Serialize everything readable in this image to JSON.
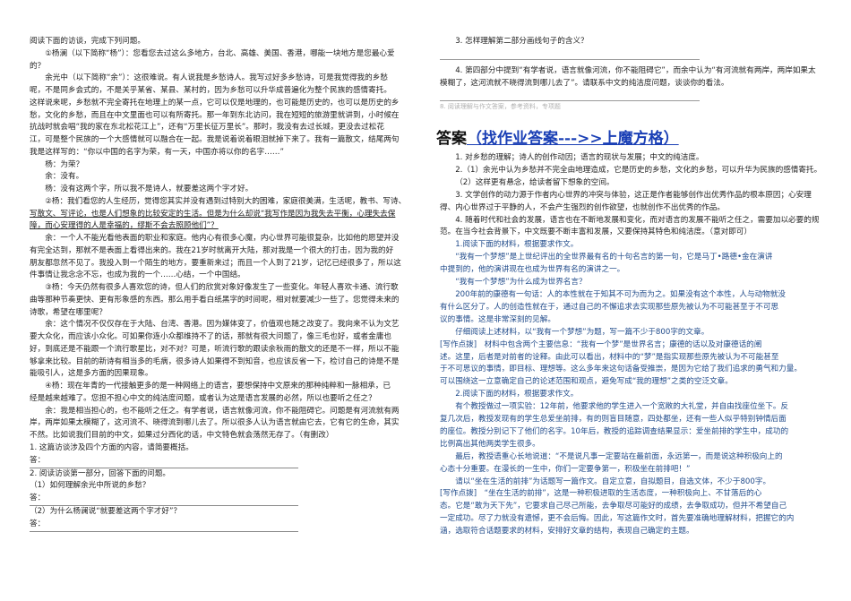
{
  "left": {
    "intro": "阅读下面的访谈，完成下列问题。",
    "paras": [
      "①杨澜（以下简称“杨”）：您看您去过这么多地方，台北、高雄、美国、香港，哪能一块地方是您最心爱",
      "的？",
      "余光中（以下简称“余”）：这很难说。有人说我是乡愁诗人。我写过好多乡愁诗，可是我觉得我的乡愁",
      "呢，不是同乡会式的，不是关乎某省、某县、某村的，因为乡愁可以升华成普遍化为整个民族的感情寄托。",
      "这样说来呢，乡愁就不完全寄托在地理上的某一点，它可以仅是地理的，也可能是历史的，也可以是历史的乡",
      "愁，文化的乡愁，而且在中文里面也可以有所寄托。那一年到东北访问，我在短短的旅游里就讲到，小时候在",
      "抗战时就会唱“我的家在东北松花江上”，还有“万里长征万里长”。那时，我没有去过长城，更没去过松花",
      "江，可是整个民族的一个大感情就可以融合在一起。我是说着说着眼泪就掉下来了。我有一篇散文，结尾两句",
      "我是这样写的：“你以中国的名字为荣，有一天，中国亦将以你的名字……”",
      "杨：为荣？",
      "余：没有。",
      "杨：没有这两个字，所以我不是诗人，就要差这两个字才好。",
      "②杨：我们看您的人生经历，觉得您其实并没有遇到过特别大的困难，家庭很美满，生活呢，教书、写诗、",
      "写散文、写评论，也是人们想象的比较安定的生活。但是为什么却说“我写作是因为我失去平衡，心理失去保",
      "障，而心安理得的人是幸福的，缪斯不会去照顾他们”？",
      "余：一个人不能光看他表面的职业和家庭。他内心有很多心魔，内心世界可能很复杂，比如他的愿望并没",
      "有完全达到，那就不是表面上看得出来的。我在21岁时就离开大陆，那对我是一个很大的打击，因为我的好",
      "朋友都忽然不见了。我投入到一个陌生的地方，要重新来过；而且一个人到了21岁，记忆已经很多了，所以这",
      "件事情让我念念不忘，也成为我的一个……心结，一个中国结。",
      "③杨：今天仍然有很多人喜欢您的诗，但人们的欣赏对象好像发生了一些变化。年轻人喜欢卡通、流行歌",
      "曲等那种节奏更快、更有形象感的东西。那么用手看白纸黑字的时间呢，相对就要减少一些了。您觉得未来的",
      "诗歌，希望在哪里呢？",
      "余：这个情况不仅仅存在于大陆、台湾、香港。因为媒体变了，价值观也随之改变了。我向来不认为文艺",
      "要大众化，而应该小众化。可如果你连小众都维持不了的话，那就有很大问题了，像三毛也好，或者金庸也",
      "好，到底还是不能跟一个流行歌星比，对不对？可是，听流行歌的跟读余秋雨的散文的还是不一样，所以不能",
      "够拿来比较。目前的新诗有相当多的毛病，很多诗人如果得不到知音，也应该反省一下，检讨自己的诗是不是",
      "能吸引人，这是多方面的因果现象。",
      "④杨：现在年青的一代接触更多的是一种网络上的语言，要想保持中文原来的那种纯粹和一脉相承，已",
      "经是越来越难了。您担不担心中文的纯洁度问题，或者认为这是语言发展的必然，所以也要听之任之？",
      "余：我是相当担心的，也不能听之任之。有学者说，语言就像河流，你不能阻碍它。问题是有河流就有两",
      "岸，两岸如果太模糊了，这河流不、晓得流到哪儿去了。所以很多人认为语言就由它去，它有它的生命，其实",
      "不然。比如说我们目前的中文，如果过分西化的话，中文特色就会荡然无存了。（有删改）"
    ],
    "q1": "1. 这篇访谈涉及四个方面的内容，请简要概括。",
    "answer_label": "答：",
    "q2": "2. 阅读访谈第一部分，回答下面的问题。",
    "q2_1": "（1）如何理解余光中所说的乡愁？",
    "q2_2": "（2）为什么杨澜说“就要差这两个字才好”？"
  },
  "right": {
    "q3": "3. 怎样理解第二部分画线句子的含义？",
    "q4a": "4. 第四部分中提到“有学者说，语言就像河流，你不能阻碍它”，而余中认为“有河流就有两岸，两岸如果太",
    "q4b": "模糊了，这河流就不晓得流到哪儿去了”。请联系中文的纯洁度问题，谈谈你的看法。",
    "faint": "8. 阅读理解与作文答案，参考资料，专项题",
    "heading_prefix": "答案",
    "heading_link": "（找作业答案--->>上魔方格）",
    "answers": [
      "1. 对乡愁的理解；诗人的创作动因；语言的现状与发展；中文的纯洁度。",
      "2.（1）余光中认为乡愁并不完全由地理造成，它是历史的乡愁，文化的乡愁，可以升华为民族的感情寄托。",
      "（2）这样更有悬念，给读者留下想象的空间。",
      "3. 文学创作的动力源于作者内心世界的冲突与体验，这正是作者能够创作出优秀作品的根本原因；心安理",
      "得、内心世界过于平静的人，不会产生强烈的创作欲望，也就创作不出优秀的作品。",
      "4. 随着时代和社会的发展，语言也在不断地发展和变化，而对语言的发展不能听之任之，需要加以必要的规",
      "范。在当今社会背景下，中文既要不断丰富和发展，又要保持其特色和纯洁度。（意对即可）"
    ],
    "essay": [
      "1.阅读下面的材料，根据要求作文。",
      "“我有一个梦想”是上世纪评出的全世界最有名的十句名言的第一句，它是马丁•路德•金在演讲",
      "中提到的，他的演讲现在也成为世界有名的演讲之一。",
      "“我有一个梦想”为什么成为世界名言？",
      "200年前的康德有一句话：人的本性就在于知其不可为而为之。如果没有这个本性，人与动物就没",
      "有什么区分了。人的创造性就在于，通过自己的不懈追求去实现那些原先被认为不可能甚至于不可思",
      "议的事情。这是非常深刻的见解。",
      "仔细阅读上述材料，以“我有一个梦想”为题，写一篇不少于800字的文章。",
      "[写作点拨]　材料中包含两个主要信息：“我有一个梦”是世界名言；康德的话以及对康德话的阐",
      "述。这里，后者是对前者的诠释。由此可以看出，材料中的“梦”是指实现那些原先被认为不可能甚至",
      "于不可思议的事情，即目标、理想等。这么多年来这句话备受推崇，是因为它给了我们追求的勇气和力量。",
      "可以围绕这一立意确定自己的论述范围和观点，避免写成“我的理想”之类的空泛文章。",
      "2.阅读下面的材料，根据要求作文。",
      "有个教授做过一项实验：12年前，他要求他的学生进入一个宽敞的大礼堂，并自由找座位坐下。反",
      "复几次后，教授发现有的学生总爱坐前排，有的则盲目随意，四处都坐，还有一些人似乎特别钟情后面",
      "的座位。教授分别记下了他们的名字。10年后，教授的追踪调查结果显示：爱坐前排的学生中，成功的",
      "比例高出其他两类学生很多。",
      "最后，教授语重心长地说道：“不是说凡事一定要站在最前面，永远第一，而是说这种积极向上的",
      "心态十分重要。在漫长的一生中，你们一定要争第一，积极坐在前排吧！”",
      "请以“坐在生活的前排”为话题写一篇作文。自定立意，自拟题目，自选文体，不少于800字。",
      "[写作点拨]　“坐在生活的前排”，这是一种积极进取的生活态度，一种积极向上、不甘落后的心",
      "态。它是“敢为天下先”，它要求自己尽己所能，去争取尽可能好的成绩，去争取成功，但并不希望自己",
      "一定成功。尽了力就没有遗憾，更不会后悔。因此，写这篇作文时，首先要准确地理解材料，把握它的内",
      "涵，选取符合话题要求的材料，安排好文章的结构，表现自己确定的主题。"
    ]
  }
}
